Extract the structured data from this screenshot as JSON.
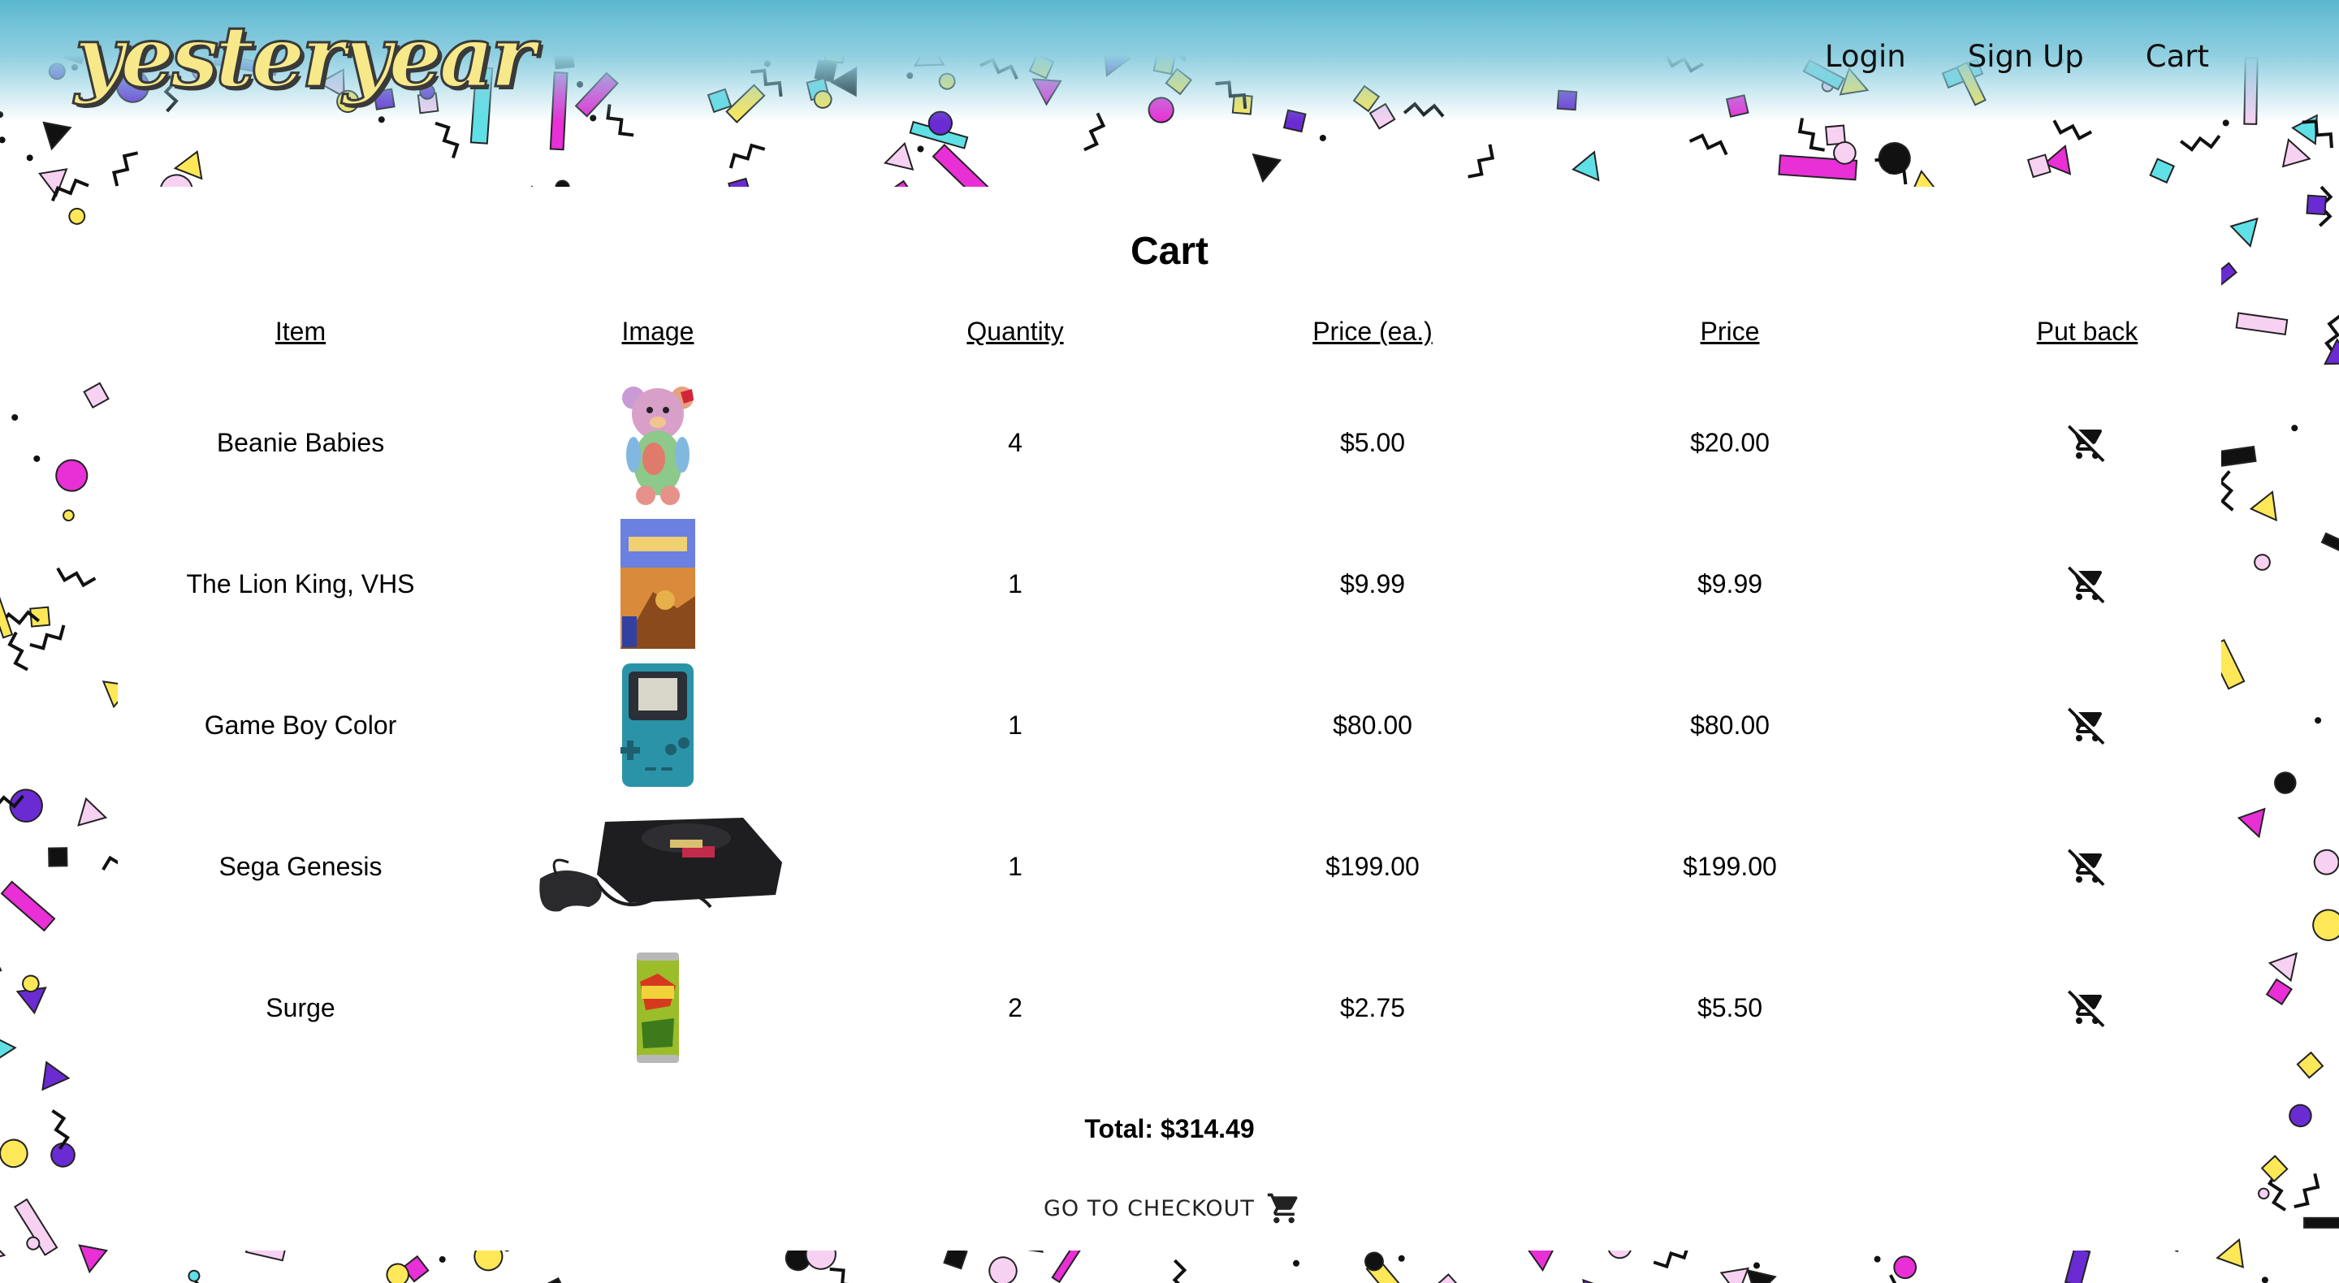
{
  "app": {
    "logo": "yesteryear"
  },
  "nav": {
    "login": "Login",
    "signup": "Sign Up",
    "cart": "Cart"
  },
  "page": {
    "title": "Cart"
  },
  "table": {
    "headers": [
      "Item",
      "Image",
      "Quantity",
      "Price (ea.)",
      "Price",
      "Put back"
    ],
    "rows": [
      {
        "item": "Beanie Babies",
        "image": "beanie-baby-bear",
        "quantity": "4",
        "price_each": "$5.00",
        "price": "$20.00"
      },
      {
        "item": "The Lion King, VHS",
        "image": "lion-king-vhs",
        "quantity": "1",
        "price_each": "$9.99",
        "price": "$9.99"
      },
      {
        "item": "Game Boy Color",
        "image": "game-boy-color",
        "quantity": "1",
        "price_each": "$80.00",
        "price": "$80.00"
      },
      {
        "item": "Sega Genesis",
        "image": "sega-genesis",
        "quantity": "1",
        "price_each": "$199.00",
        "price": "$199.00"
      },
      {
        "item": "Surge",
        "image": "surge-can",
        "quantity": "2",
        "price_each": "$2.75",
        "price": "$5.50"
      }
    ]
  },
  "total": "Total: $314.49",
  "checkout": {
    "label": "GO TO CHECKOUT",
    "icon": "shopping-cart-icon"
  },
  "icons": {
    "remove": "remove-from-cart-icon"
  },
  "colors": {
    "header_blue": "#5bb8cf",
    "logo_yellow": "#f7e98a",
    "confetti": [
      "#ffe857",
      "#e92fd6",
      "#6a2bd2",
      "#5fe0e6",
      "#f7d1f2",
      "#111111"
    ]
  }
}
